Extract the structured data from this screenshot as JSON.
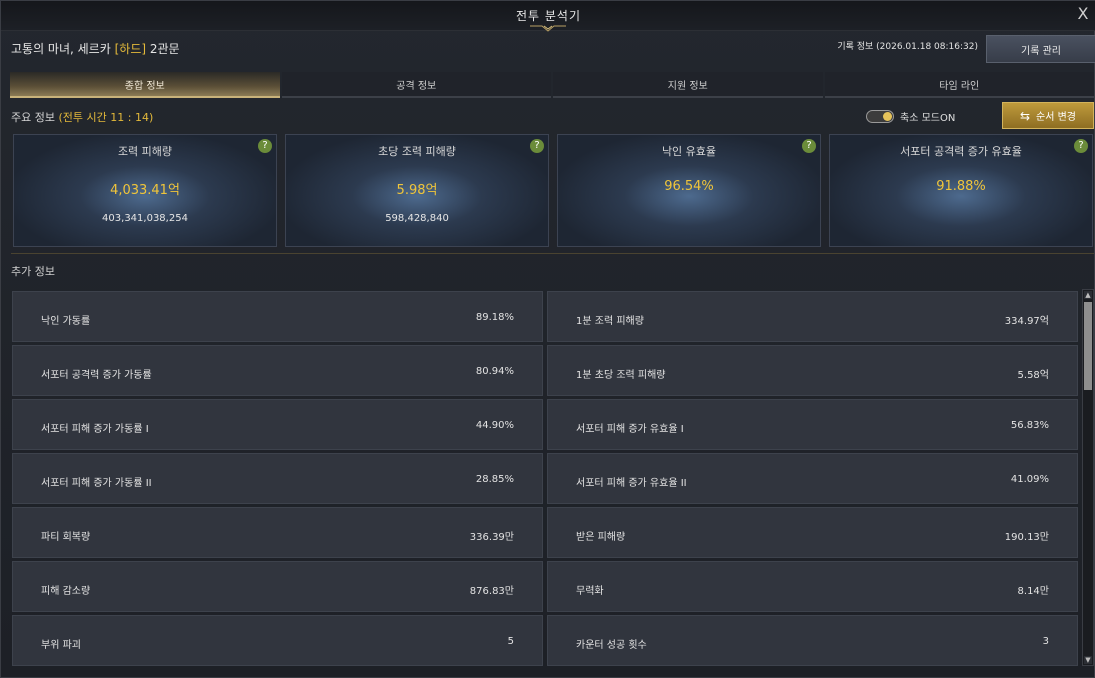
{
  "window": {
    "title": "전투 분석기",
    "close_glyph": "X"
  },
  "header": {
    "boss_name": "고통의 마녀, 세르카",
    "difficulty": "[하드]",
    "gate": "2관문",
    "record_info": "기록 정보 (2026.01.18 08:16:32)",
    "record_button": "기록 관리"
  },
  "tabs": [
    {
      "label": "종합 정보",
      "active": true
    },
    {
      "label": "공격 정보",
      "active": false
    },
    {
      "label": "지원 정보",
      "active": false
    },
    {
      "label": "타임 라인",
      "active": false
    }
  ],
  "main": {
    "label": "주요 정보",
    "battle_time": "(전투 시간 11 : 14)",
    "toggle_label": "축소 모드ON",
    "toggle_on": true,
    "order_button": "순서 변경",
    "cards": [
      {
        "title": "조력 피해량",
        "value": "4,033.41억",
        "sub": "403,341,038,254"
      },
      {
        "title": "초당 조력 피해량",
        "value": "5.98억",
        "sub": "598,428,840"
      },
      {
        "title": "낙인 유효율",
        "value": "96.54%",
        "sub": ""
      },
      {
        "title": "서포터 공격력 증가 유효율",
        "value": "91.88%",
        "sub": ""
      }
    ],
    "help_glyph": "?"
  },
  "extra": {
    "label": "추가 정보",
    "rows": [
      {
        "left_label": "낙인 가동률",
        "left_value": "89.18%",
        "right_label": "1분 조력 피해량",
        "right_value": "334.97억"
      },
      {
        "left_label": "서포터 공격력 증가 가동률",
        "left_value": "80.94%",
        "right_label": "1분 초당 조력 피해량",
        "right_value": "5.58억"
      },
      {
        "left_label": "서포터 피해 증가 가동률 I",
        "left_value": "44.90%",
        "right_label": "서포터 피해 증가 유효율 I",
        "right_value": "56.83%"
      },
      {
        "left_label": "서포터 피해 증가 가동률 II",
        "left_value": "28.85%",
        "right_label": "서포터 피해 증가 유효율 II",
        "right_value": "41.09%"
      },
      {
        "left_label": "파티 회복량",
        "left_value": "336.39만",
        "right_label": "받은 피해량",
        "right_value": "190.13만"
      },
      {
        "left_label": "피해 감소량",
        "left_value": "876.83만",
        "right_label": "무력화",
        "right_value": "8.14만"
      },
      {
        "left_label": "부위 파괴",
        "left_value": "5",
        "right_label": "카운터 성공 횟수",
        "right_value": "3"
      }
    ]
  },
  "colors": {
    "accent_gold": "#e3b93a",
    "help_green": "#6b8c3a",
    "order_button": "#bf9a3c"
  },
  "icons": {
    "swap": "swap-arrows-icon",
    "help": "help-icon",
    "close": "close-icon"
  }
}
